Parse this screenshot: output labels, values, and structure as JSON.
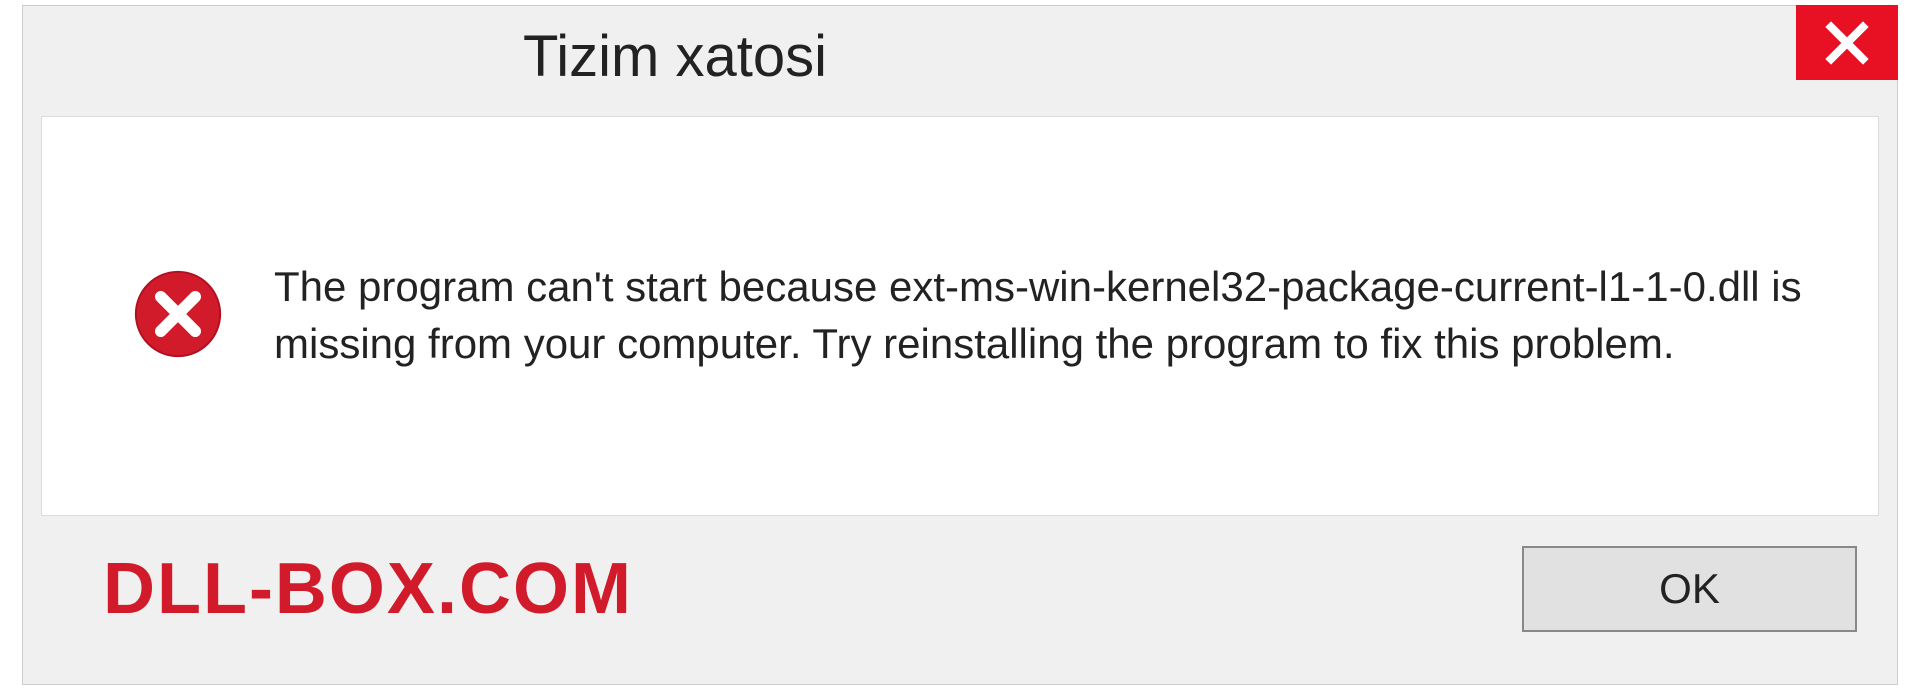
{
  "dialog": {
    "title": "Tizim xatosi",
    "message": "The program can't start because ext-ms-win-kernel32-package-current-l1-1-0.dll is missing from your computer. Try reinstalling the program to fix this problem.",
    "ok_label": "OK"
  },
  "watermark": "DLL-BOX.COM",
  "colors": {
    "close_bg": "#e81123",
    "error_icon": "#d11a2a",
    "watermark": "#d11a2a"
  }
}
